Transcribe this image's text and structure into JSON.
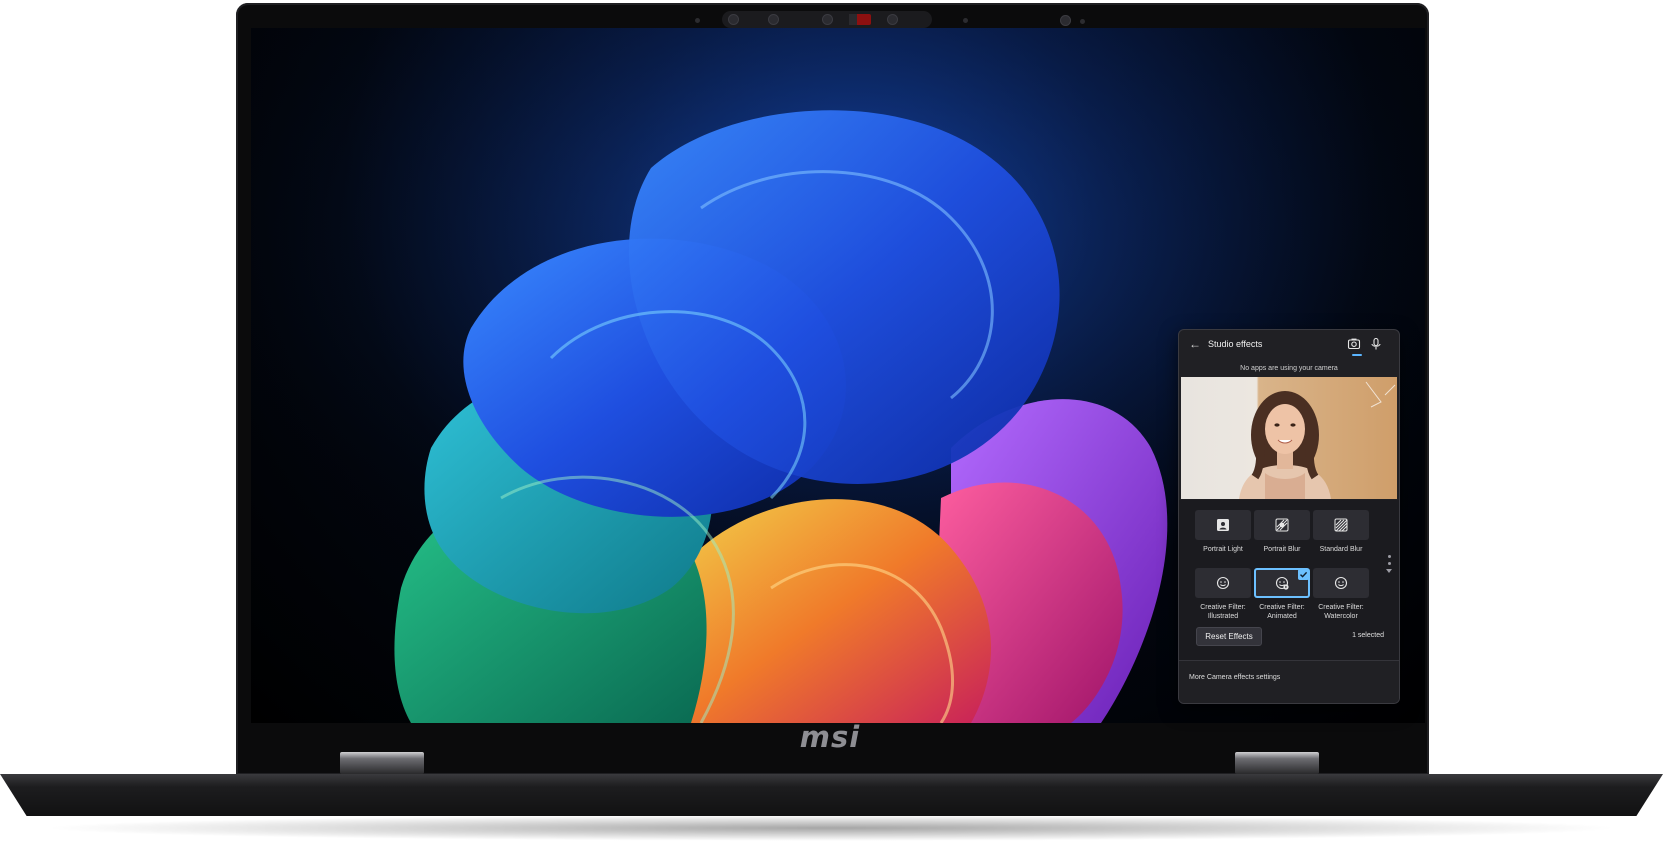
{
  "brand": {
    "logo_text": "msi"
  },
  "flyout": {
    "title": "Studio effects",
    "status_message": "No apps are using your camera",
    "effects": [
      {
        "label": "Portrait Light",
        "icon": "portrait-light-icon",
        "selected": false
      },
      {
        "label": "Portrait Blur",
        "icon": "portrait-blur-icon",
        "selected": false
      },
      {
        "label": "Standard Blur",
        "icon": "standard-blur-icon",
        "selected": false
      },
      {
        "label": "Creative Filter: Illustrated",
        "icon": "face-filter-icon",
        "selected": false
      },
      {
        "label": "Creative Filter: Animated",
        "icon": "face-filter-animated-icon",
        "selected": true
      },
      {
        "label": "Creative Filter: Watercolor",
        "icon": "face-filter-icon",
        "selected": false
      }
    ],
    "reset_label": "Reset Effects",
    "selected_count": "1 selected",
    "footer_link": "More Camera effects settings"
  },
  "colors": {
    "accent": "#6cc0ff",
    "flyout_bg": "#202024",
    "camera_privacy_shutter": "#8d1010"
  }
}
